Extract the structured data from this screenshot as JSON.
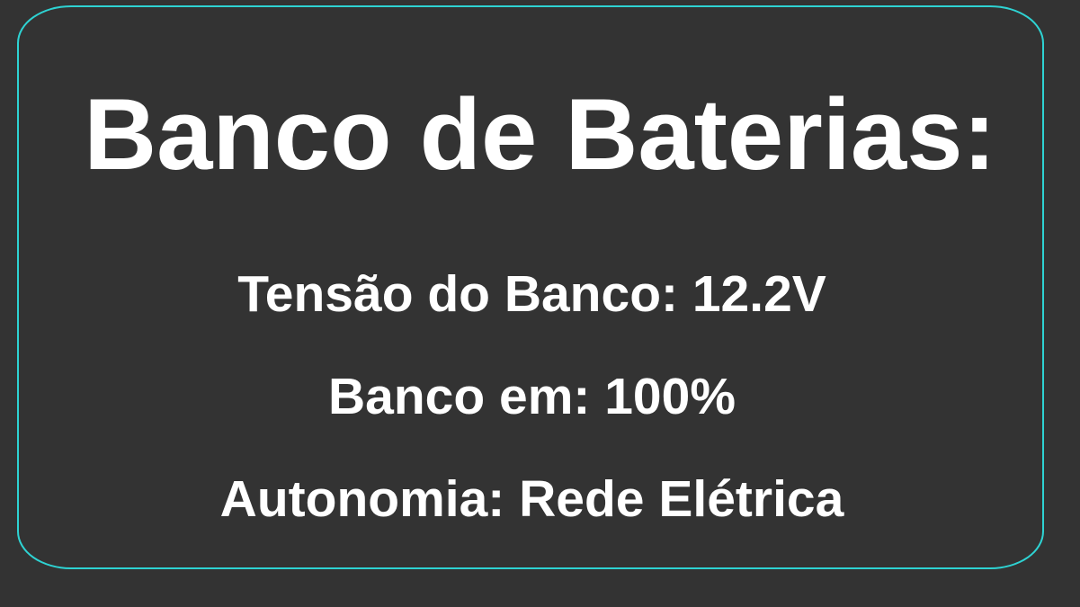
{
  "colors": {
    "background": "#333333",
    "panel_border": "#2ed3d3",
    "text": "#ffffff"
  },
  "panel": {
    "title": "Banco de Baterias:",
    "lines": [
      "Tensão do Banco: 12.2V",
      "Banco em: 100%",
      "Autonomia: Rede Elétrica"
    ]
  }
}
